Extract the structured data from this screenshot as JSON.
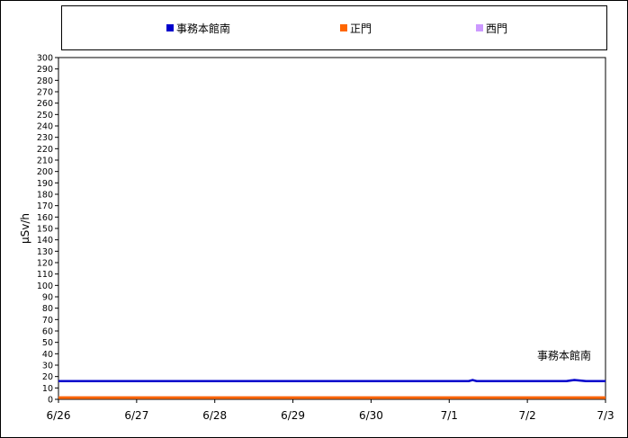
{
  "chart_data": {
    "type": "line",
    "title": "",
    "xlabel": "",
    "ylabel": "μSv/h",
    "ylim": [
      0,
      300
    ],
    "ytick_step": 10,
    "x_categories": [
      "6/26",
      "6/27",
      "6/28",
      "6/29",
      "6/30",
      "7/1",
      "7/2",
      "7/3"
    ],
    "xlim": [
      0,
      7
    ],
    "grid": false,
    "legend_position": "top",
    "annotation": "事務本館南",
    "series": [
      {
        "name": "事務本館南",
        "color": "#0000cc",
        "x": [
          0,
          0.5,
          1,
          1.5,
          2,
          2.5,
          3,
          3.5,
          4,
          4.5,
          5,
          5.25,
          5.3,
          5.35,
          6,
          6.5,
          6.6,
          6.75,
          7
        ],
        "y": [
          16,
          16,
          16,
          16,
          16,
          16,
          16,
          16,
          16,
          16,
          16,
          16,
          17,
          16,
          16,
          16,
          17,
          16,
          16
        ]
      },
      {
        "name": "正門",
        "color": "#ff6600",
        "x": [
          0,
          7
        ],
        "y": [
          1.5,
          1.5
        ]
      },
      {
        "name": "西門",
        "color": "#cc99ff",
        "x": [
          0,
          7
        ],
        "y": [
          1.5,
          1.5
        ]
      }
    ]
  },
  "legend": {
    "items": [
      {
        "label": "事務本館南",
        "color": "#0000cc"
      },
      {
        "label": "正門",
        "color": "#ff6600"
      },
      {
        "label": "西門",
        "color": "#cc99ff"
      }
    ]
  }
}
